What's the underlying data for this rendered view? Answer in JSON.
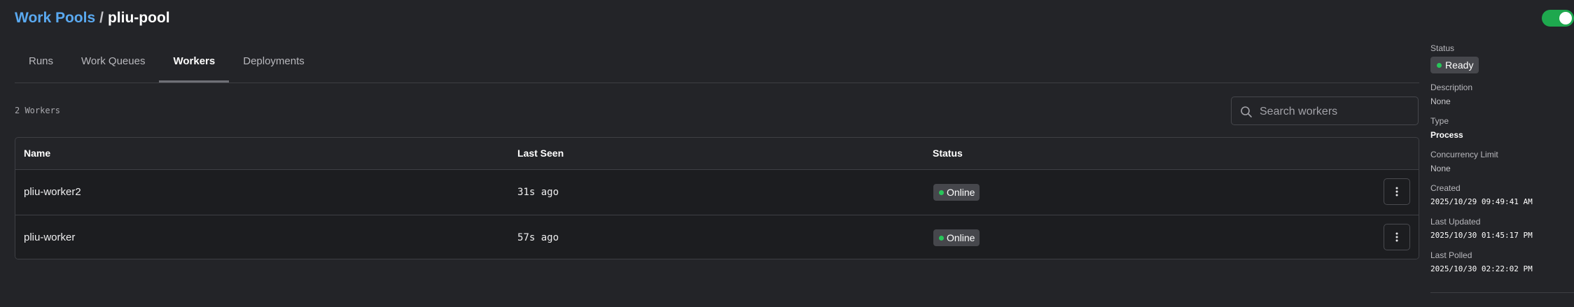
{
  "breadcrumb": {
    "parent": "Work Pools",
    "separator": "/",
    "current": "pliu-pool"
  },
  "toggle": {
    "state": "on"
  },
  "tabs": [
    {
      "label": "Runs",
      "active": false
    },
    {
      "label": "Work Queues",
      "active": false
    },
    {
      "label": "Workers",
      "active": true
    },
    {
      "label": "Deployments",
      "active": false
    }
  ],
  "workers": {
    "count_label": "2 Workers",
    "search_placeholder": "Search workers",
    "columns": {
      "name": "Name",
      "last_seen": "Last Seen",
      "status": "Status"
    },
    "rows": [
      {
        "name": "pliu-worker2",
        "last_seen": "31s ago",
        "status": "Online"
      },
      {
        "name": "pliu-worker",
        "last_seen": "57s ago",
        "status": "Online"
      }
    ]
  },
  "details": {
    "status_label": "Status",
    "status_value": "Ready",
    "description_label": "Description",
    "description_value": "None",
    "type_label": "Type",
    "type_value": "Process",
    "concurrency_label": "Concurrency Limit",
    "concurrency_value": "None",
    "created_label": "Created",
    "created_value": "2025/10/29 09:49:41 AM",
    "updated_label": "Last Updated",
    "updated_value": "2025/10/30 01:45:17 PM",
    "polled_label": "Last Polled",
    "polled_value": "2025/10/30 02:22:02 PM"
  },
  "colors": {
    "background": "#232428",
    "accent_link": "#5aa9f0",
    "status_online": "#28c65a",
    "toggle_on": "#1ea84e"
  },
  "icons": [
    "search-icon",
    "more-vertical-icon",
    "status-dot-icon"
  ]
}
